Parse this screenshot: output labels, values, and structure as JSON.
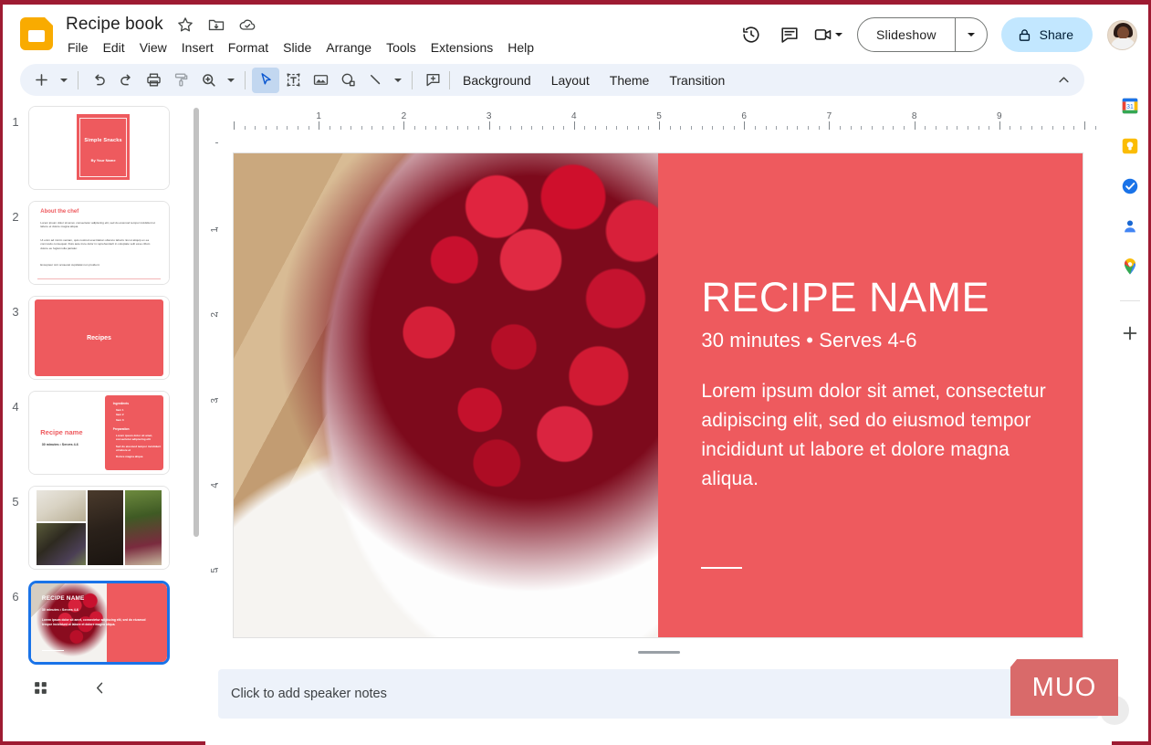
{
  "app": {
    "name": "Google Slides",
    "logo_icon": "slides-logo-icon",
    "accent_color": "#ee5a5e",
    "brand_yellow": "#F9AB00"
  },
  "header": {
    "doc_title": "Recipe book",
    "title_icons": [
      {
        "name": "star-icon",
        "glyph": "star"
      },
      {
        "name": "move-to-folder-icon",
        "glyph": "folder-move"
      },
      {
        "name": "cloud-saved-icon",
        "glyph": "cloud-check"
      }
    ],
    "menus": [
      "File",
      "Edit",
      "View",
      "Insert",
      "Format",
      "Slide",
      "Arrange",
      "Tools",
      "Extensions",
      "Help"
    ],
    "actions": {
      "version_history_icon": "history-icon",
      "comments_icon": "comment-icon",
      "meet_icon": "video-camera-icon",
      "slideshow_label": "Slideshow",
      "slideshow_caret_icon": "chevron-down-icon",
      "share_label": "Share",
      "share_lock_icon": "lock-icon",
      "avatar_name": "account-avatar"
    }
  },
  "toolbar": {
    "icons": [
      {
        "name": "new-slide-icon",
        "glyph": "plus"
      },
      {
        "name": "new-slide-caret-icon",
        "glyph": "caret"
      },
      {
        "name": "undo-icon",
        "glyph": "undo"
      },
      {
        "name": "redo-icon",
        "glyph": "redo"
      },
      {
        "name": "print-icon",
        "glyph": "print"
      },
      {
        "name": "paint-format-icon",
        "glyph": "format-paint"
      },
      {
        "name": "zoom-icon",
        "glyph": "zoom"
      },
      {
        "name": "zoom-caret-icon",
        "glyph": "caret"
      },
      {
        "name": "select-tool-icon",
        "glyph": "cursor"
      },
      {
        "name": "text-box-icon",
        "glyph": "textbox"
      },
      {
        "name": "insert-image-icon",
        "glyph": "image"
      },
      {
        "name": "shape-icon",
        "glyph": "shape"
      },
      {
        "name": "line-icon",
        "glyph": "line"
      },
      {
        "name": "line-caret-icon",
        "glyph": "caret"
      },
      {
        "name": "insert-comment-icon",
        "glyph": "add-comment"
      }
    ],
    "labels": [
      "Background",
      "Layout",
      "Theme",
      "Transition"
    ],
    "collapse_icon": "chevron-up-icon"
  },
  "filmstrip": {
    "bottom_buttons": [
      {
        "name": "grid-view-button",
        "icon": "grid-icon"
      },
      {
        "name": "collapse-filmstrip-button",
        "icon": "chevron-left-icon"
      }
    ],
    "slides": [
      {
        "number": "1",
        "selected": false,
        "kind": "title",
        "title": "Simple Snacks",
        "subtitle": "By Your Name"
      },
      {
        "number": "2",
        "selected": false,
        "kind": "text",
        "heading": "About the chef",
        "paragraphs": [
          "Lorem ipsum dolor sit amet, consectetur adipiscing elit, sed do eiusmod tempor incididunt ut labore et dolore magna aliqua.",
          "Ut enim ad minim veniam, quis nostrud exercitation ullamco laboris nisi ut aliquip ex ea commodo consequat. Duis aute irure dolor in reprehenderit in voluptate velit esse cillum dolore eu fugiat nulla pariatur.",
          "Excepteur sint occaecat cupidatat non proident."
        ]
      },
      {
        "number": "3",
        "selected": false,
        "kind": "section",
        "title": "Recipes"
      },
      {
        "number": "4",
        "selected": false,
        "kind": "recipe",
        "title": "Recipe name",
        "meta": "30 minutes • Serves 4-6",
        "ingredients_label": "Ingredients",
        "ingredients": [
          "Item 1",
          "Item 2",
          "Item 3"
        ],
        "preparation_label": "Preparation",
        "steps": [
          "Lorem ipsum dolor sit amet, consectetur adipiscing elit",
          "Sed do eiusmod tempor incididunt ut labore et",
          "Dolore magna aliqua"
        ]
      },
      {
        "number": "5",
        "selected": false,
        "kind": "collage",
        "photos": [
          "garlic-and-oil",
          "blackberries",
          "mortar-and-pestle",
          "onion-and-herbs"
        ]
      },
      {
        "number": "6",
        "selected": true,
        "kind": "recipe-photo",
        "title": "RECIPE NAME",
        "meta": "30 minutes • Serves 4-6",
        "body": "Lorem ipsum dolor sit amet, consectetur adipiscing elit, sed do eiusmod tempor incididunt ut labore et dolore magna aliqua.",
        "photo": "raspberries-in-white-cup"
      }
    ]
  },
  "ruler": {
    "horizontal_labels": [
      "1",
      "2",
      "3",
      "4",
      "5",
      "6",
      "7",
      "8",
      "9"
    ],
    "vertical_labels": [
      "1",
      "2",
      "3",
      "4",
      "5"
    ],
    "unit": "inches"
  },
  "slide": {
    "photo_name": "raspberries-in-white-cup",
    "title": "RECIPE NAME",
    "meta": "30 minutes • Serves 4-6",
    "body": "Lorem ipsum dolor sit amet, consectetur adipiscing elit, sed do eiusmod tempor incididunt ut labore et dolore magna aliqua.",
    "panel_color": "#ee5a5e"
  },
  "notes": {
    "placeholder": "Click to add speaker notes"
  },
  "rail": {
    "items": [
      {
        "name": "google-calendar-icon",
        "label": "Calendar"
      },
      {
        "name": "google-keep-icon",
        "label": "Keep"
      },
      {
        "name": "google-tasks-icon",
        "label": "Tasks"
      },
      {
        "name": "google-contacts-icon",
        "label": "Contacts"
      },
      {
        "name": "google-maps-icon",
        "label": "Maps"
      },
      {
        "name": "get-add-ons-icon",
        "label": "Get Add-ons"
      }
    ]
  },
  "watermark": {
    "text": "MUO"
  }
}
